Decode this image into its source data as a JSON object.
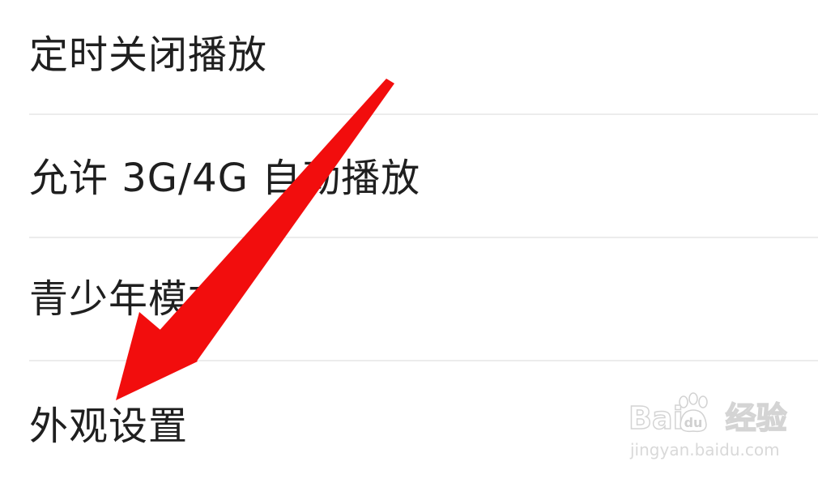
{
  "settings": {
    "items": [
      {
        "label": "定时关闭播放"
      },
      {
        "label": "允许 3G/4G 自动播放"
      },
      {
        "label": "青少年模式"
      },
      {
        "label": "外观设置"
      }
    ]
  },
  "annotation": {
    "arrow_color": "#f20d0d",
    "arrow_target": "外观设置"
  },
  "watermark": {
    "brand_left": "Bai",
    "brand_right": "经验",
    "url": "jingyan.baidu.com"
  }
}
